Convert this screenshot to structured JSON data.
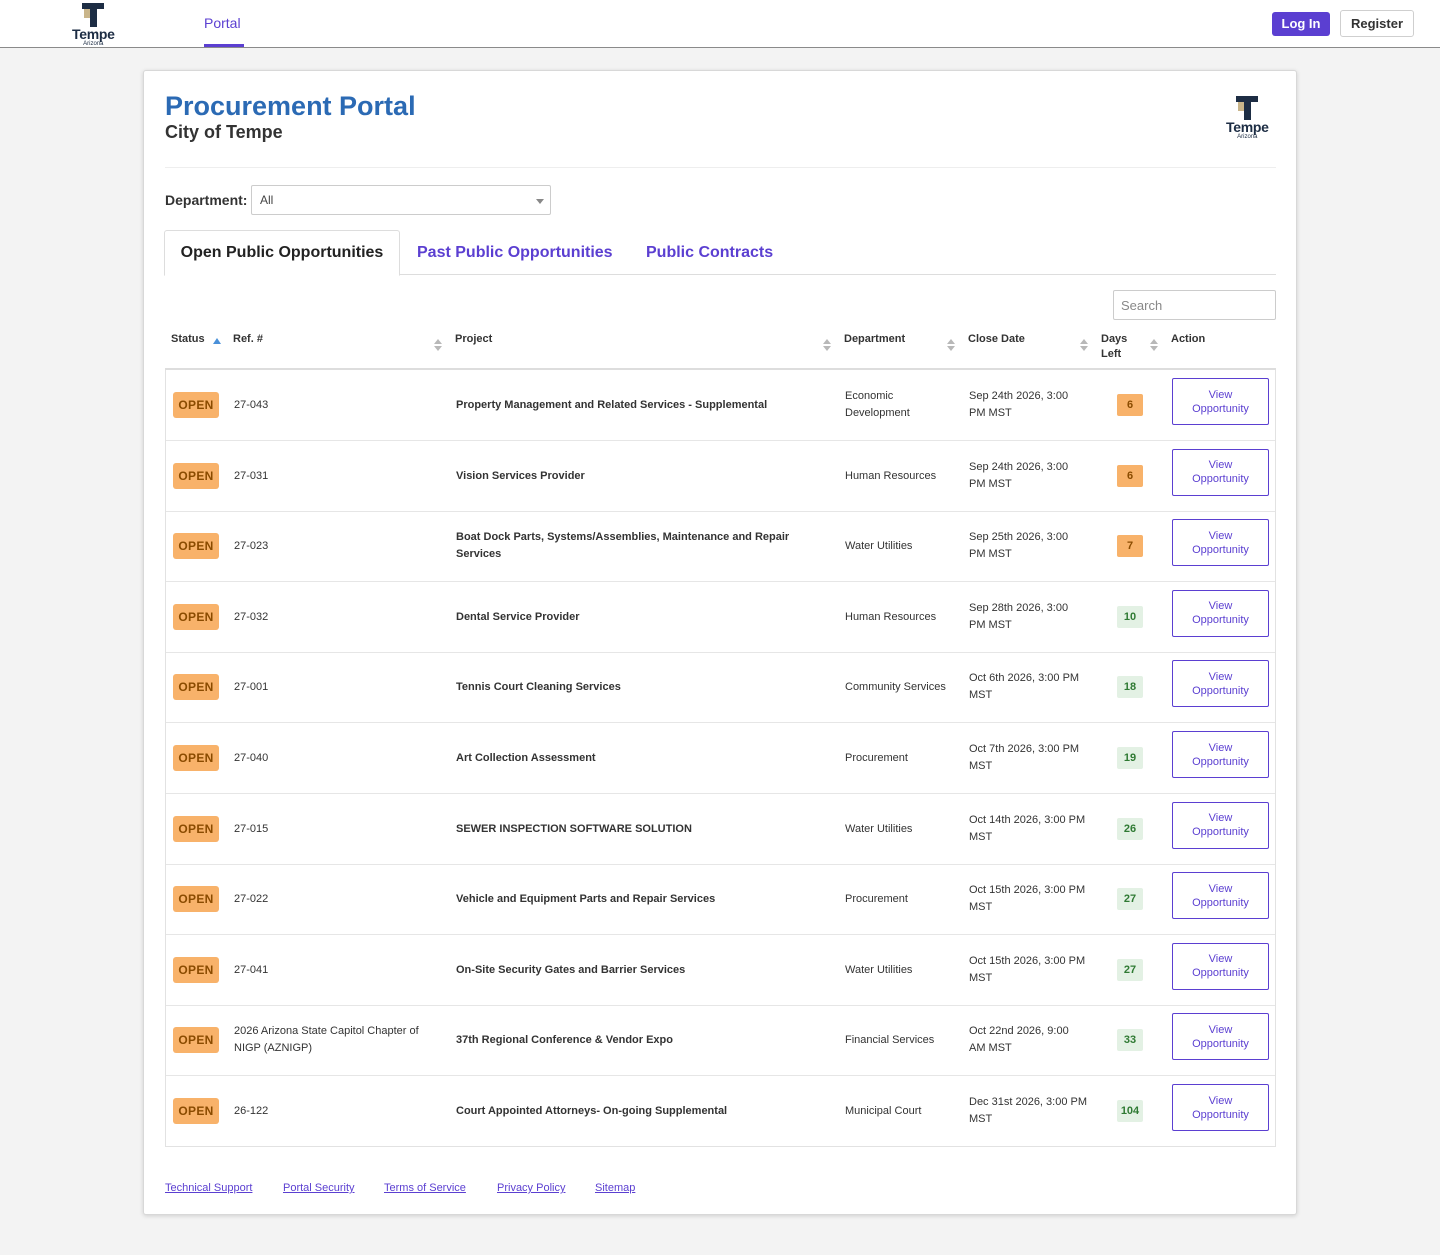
{
  "nav": {
    "logo_text": "Tempe",
    "logo_sub": "Arizona",
    "portal_link": "Portal",
    "login": "Log In",
    "register": "Register"
  },
  "header": {
    "title": "Procurement Portal",
    "subtitle": "City of Tempe",
    "logo_text": "Tempe",
    "logo_sub": "Arizona"
  },
  "filter": {
    "label": "Department:",
    "value": "All"
  },
  "tabs": [
    {
      "label": "Open Public Opportunities",
      "active": true
    },
    {
      "label": "Past Public Opportunities",
      "active": false
    },
    {
      "label": "Public Contracts",
      "active": false
    }
  ],
  "search": {
    "placeholder": "Search"
  },
  "table": {
    "columns": [
      "Status",
      "Ref. #",
      "Project",
      "Department",
      "Close Date",
      "Days Left",
      "Action"
    ],
    "days_left_lines": [
      "Days",
      "Left"
    ],
    "action_label": [
      "View",
      "Opportunity"
    ],
    "rows": [
      {
        "status": "OPEN",
        "ref": "27-043",
        "project": "Property Management and Related Services - Supplemental",
        "department": "Economic Development",
        "close_date": "Sep 24th 2026, 3:00 PM MST",
        "days": "6",
        "tone": "orange"
      },
      {
        "status": "OPEN",
        "ref": "27-031",
        "project": "Vision Services Provider",
        "department": "Human Resources",
        "close_date": "Sep 24th 2026, 3:00 PM MST",
        "days": "6",
        "tone": "orange"
      },
      {
        "status": "OPEN",
        "ref": "27-023",
        "project": "Boat Dock Parts, Systems/Assemblies, Maintenance and Repair Services",
        "department": "Water Utilities",
        "close_date": "Sep 25th 2026, 3:00 PM MST",
        "days": "7",
        "tone": "orange"
      },
      {
        "status": "OPEN",
        "ref": "27-032",
        "project": "Dental Service Provider",
        "department": "Human Resources",
        "close_date": "Sep 28th 2026, 3:00 PM MST",
        "days": "10",
        "tone": "green"
      },
      {
        "status": "OPEN",
        "ref": "27-001",
        "project": "Tennis Court Cleaning Services",
        "department": "Community Services",
        "close_date": "Oct 6th 2026, 3:00 PM MST",
        "days": "18",
        "tone": "green"
      },
      {
        "status": "OPEN",
        "ref": "27-040",
        "project": "Art Collection Assessment",
        "department": "Procurement",
        "close_date": "Oct 7th 2026, 3:00 PM MST",
        "days": "19",
        "tone": "green"
      },
      {
        "status": "OPEN",
        "ref": "27-015",
        "project": "SEWER INSPECTION SOFTWARE SOLUTION",
        "department": "Water Utilities",
        "close_date": "Oct 14th 2026, 3:00 PM MST",
        "days": "26",
        "tone": "green"
      },
      {
        "status": "OPEN",
        "ref": "27-022",
        "project": "Vehicle and Equipment Parts and Repair Services",
        "department": "Procurement",
        "close_date": "Oct 15th 2026, 3:00 PM MST",
        "days": "27",
        "tone": "green"
      },
      {
        "status": "OPEN",
        "ref": "27-041",
        "project": "On-Site Security Gates and Barrier Services",
        "department": "Water Utilities",
        "close_date": "Oct 15th 2026, 3:00 PM MST",
        "days": "27",
        "tone": "green"
      },
      {
        "status": "OPEN",
        "ref": "2026 Arizona State Capitol Chapter of NIGP (AZNIGP)",
        "project": "37th Regional Conference & Vendor Expo",
        "department": "Financial Services",
        "close_date": "Oct 22nd 2026, 9:00 AM MST",
        "days": "33",
        "tone": "green"
      },
      {
        "status": "OPEN",
        "ref": "26-122",
        "project": "Court Appointed Attorneys- On-going Supplemental",
        "department": "Municipal Court",
        "close_date": "Dec 31st 2026, 3:00 PM MST",
        "days": "104",
        "tone": "green"
      }
    ]
  },
  "footer": {
    "links": [
      "Technical Support",
      "Portal Security",
      "Terms of Service",
      "Privacy Policy",
      "Sitemap"
    ]
  },
  "colors": {
    "accent": "#5b3fd1",
    "title_blue": "#2b6ab4",
    "badge_orange": "#f8b26a",
    "badge_green_bg": "#e3f1e4",
    "badge_green_text": "#2f7a33"
  }
}
